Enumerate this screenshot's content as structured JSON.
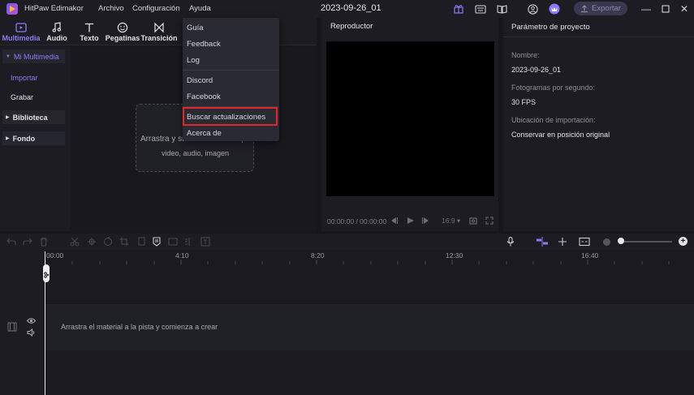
{
  "titlebar": {
    "app_name": "HitPaw Edimakor",
    "menus": [
      "Archivo",
      "Configuración",
      "Ayuda"
    ],
    "project_title": "2023-09-26_01",
    "export_label": "Exportar"
  },
  "media_tools": [
    {
      "label": "Multimedia",
      "icon": "play-square-icon"
    },
    {
      "label": "Audio",
      "icon": "music-note-icon"
    },
    {
      "label": "Texto",
      "icon": "text-t-icon"
    },
    {
      "label": "Pegatinas",
      "icon": "smiley-icon"
    },
    {
      "label": "Transición",
      "icon": "bowtie-icon"
    }
  ],
  "nav": {
    "mi_multimedia": "Mi Multimedia",
    "importar": "Importar",
    "grabar": "Grabar",
    "biblioteca": "Biblioteca",
    "fondo": "Fondo"
  },
  "dropzone": {
    "line1": "Arrastra y suelta archivos aquí",
    "line2": "video, audio, imagen"
  },
  "player": {
    "title": "Reproductor",
    "time": "00:00:00 / 00:00:00",
    "ratio": "16:9"
  },
  "params": {
    "title": "Parámetro de proyecto",
    "name_label": "Nombre:",
    "name_value": "2023-09-26_01",
    "fps_label": "Fotogramas por segundo:",
    "fps_value": "30 FPS",
    "import_label": "Ubicación de importación:",
    "import_value": "Conservar en posición original"
  },
  "timeline": {
    "ticks": [
      "00:00",
      "4:10",
      "8:20",
      "12:30",
      "16:40"
    ],
    "track_hint": "Arrastra el material a la pista y comienza a crear"
  },
  "help_menu": {
    "items": [
      "Guía",
      "Feedback",
      "Log",
      "Discord",
      "Facebook",
      "Buscar actualizaciones",
      "Acerca de"
    ]
  },
  "colors": {
    "accent": "#8b7cf6",
    "highlight": "#e0262c"
  }
}
